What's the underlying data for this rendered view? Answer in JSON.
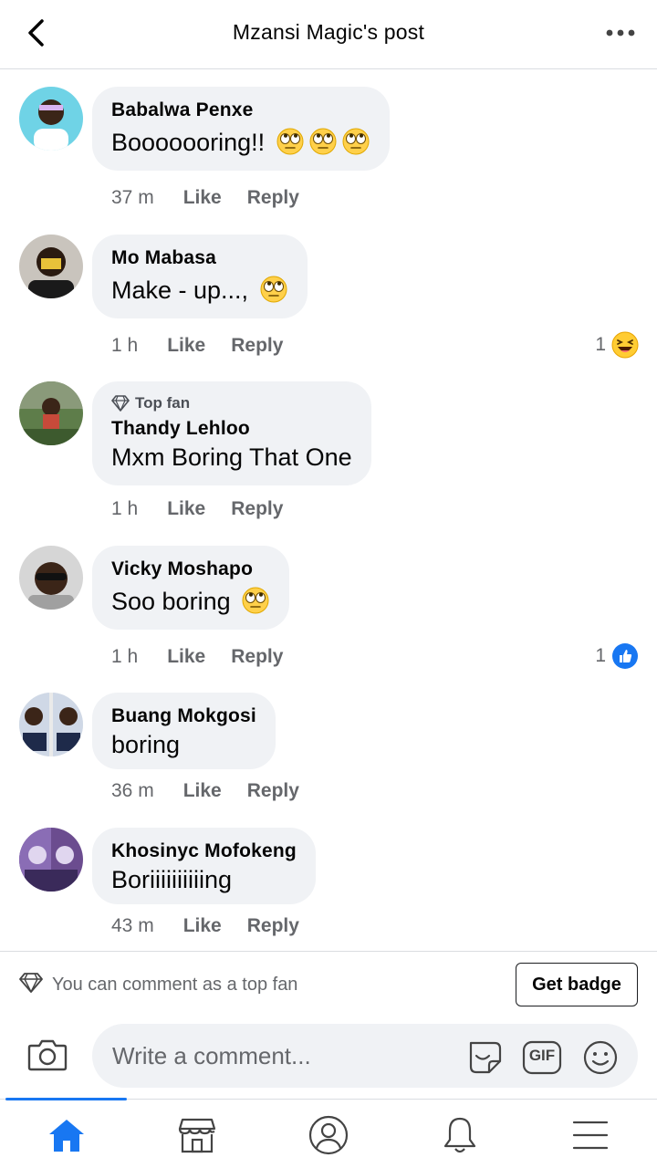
{
  "header": {
    "title": "Mzansi Magic's post",
    "back_icon": "chevron-left-icon",
    "more_icon": "more-horizontal-icon"
  },
  "comments": [
    {
      "author": "Babalwa Penxe",
      "text": "Booooooring!!",
      "emojis": [
        "face-with-rolling-eyes",
        "face-with-rolling-eyes",
        "face-with-rolling-eyes"
      ],
      "time": "37 m",
      "like_label": "Like",
      "reply_label": "Reply"
    },
    {
      "author": "Mo Mabasa",
      "text": "Make - up...,",
      "emojis": [
        "face-with-rolling-eyes"
      ],
      "time": "1 h",
      "like_label": "Like",
      "reply_label": "Reply",
      "reaction_count": "1",
      "reaction_type": "haha-icon"
    },
    {
      "badge": "Top fan",
      "author": "Thandy Lehloo",
      "text": "Mxm Boring That One",
      "time": "1 h",
      "like_label": "Like",
      "reply_label": "Reply"
    },
    {
      "author": "Vicky Moshapo",
      "text": "Soo boring",
      "emojis": [
        "face-with-rolling-eyes"
      ],
      "time": "1 h",
      "like_label": "Like",
      "reply_label": "Reply",
      "reaction_count": "1",
      "reaction_type": "like-icon"
    },
    {
      "author": "Buang Mokgosi",
      "text": "boring",
      "time": "36 m",
      "like_label": "Like",
      "reply_label": "Reply"
    },
    {
      "author": "Khosinyc Mofokeng",
      "text": "Boriiiiiiiiiing",
      "time": "43 m",
      "like_label": "Like",
      "reply_label": "Reply"
    }
  ],
  "topfan_bar": {
    "text": "You can comment as a top fan",
    "button_label": "Get badge"
  },
  "composer": {
    "placeholder": "Write a comment...",
    "gif_label": "GIF"
  },
  "bottom_nav": {
    "items": [
      "home-icon",
      "marketplace-icon",
      "profile-icon",
      "notifications-icon",
      "menu-icon"
    ],
    "active": "home-icon"
  },
  "colors": {
    "accent": "#1877f2",
    "bubble": "#f0f2f5",
    "secondary_text": "#65676b",
    "divider": "#dadde1"
  }
}
